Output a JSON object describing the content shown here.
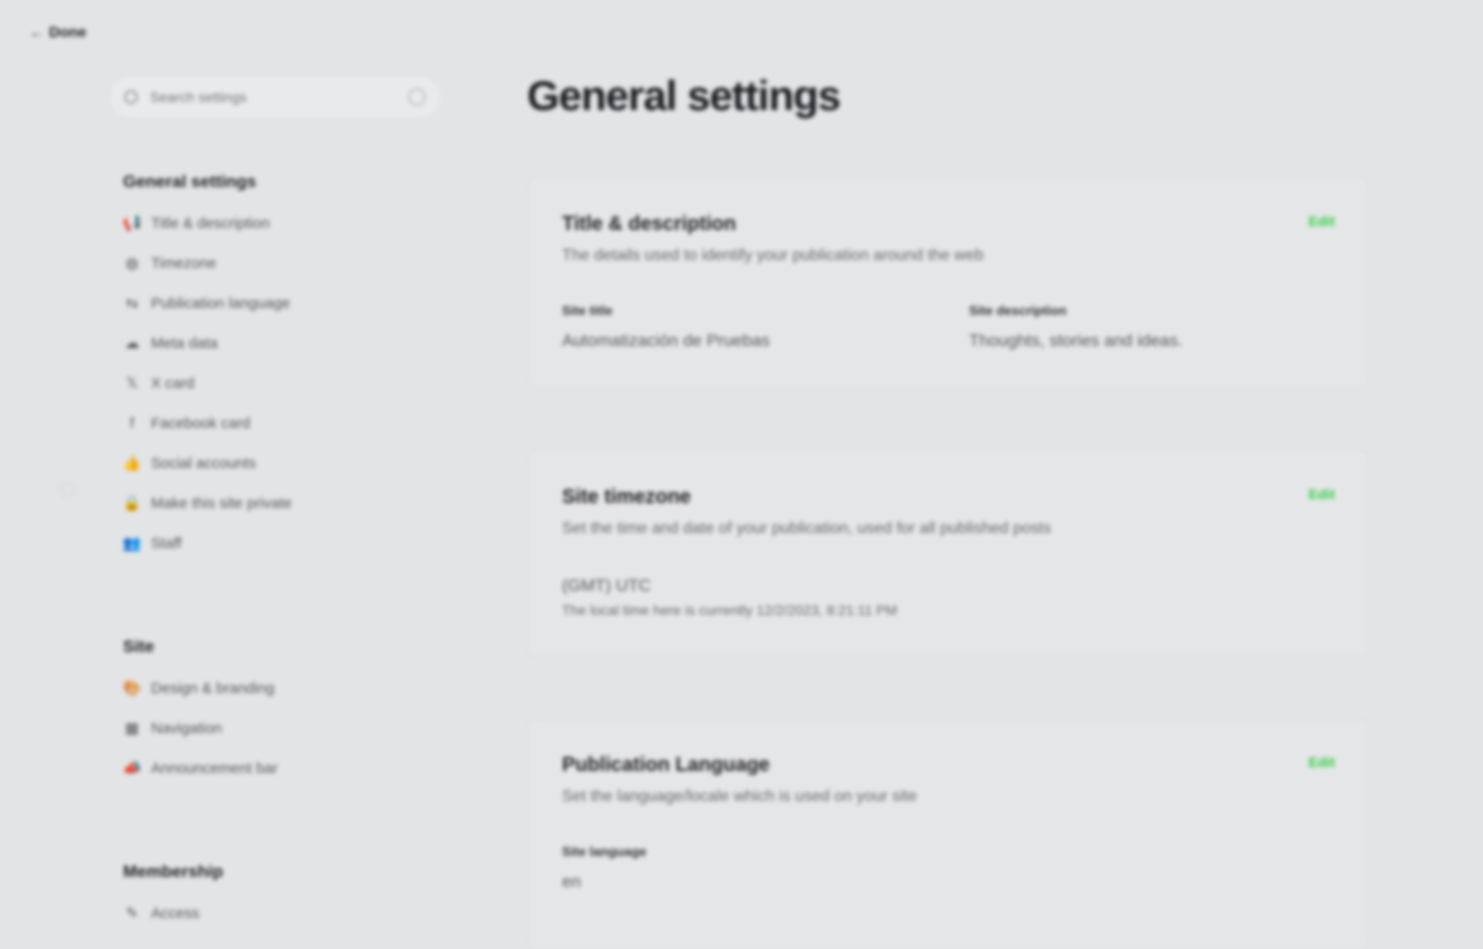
{
  "back_label": "Done",
  "search": {
    "placeholder": "Search settings"
  },
  "sidebar": {
    "groups": [
      {
        "title": "General settings",
        "items": [
          {
            "label": "Title & description",
            "icon": "megaphone-icon"
          },
          {
            "label": "Timezone",
            "icon": "globe-icon"
          },
          {
            "label": "Publication language",
            "icon": "translate-icon"
          },
          {
            "label": "Meta data",
            "icon": "brain-icon"
          },
          {
            "label": "X card",
            "icon": "x-logo-icon"
          },
          {
            "label": "Facebook card",
            "icon": "facebook-icon"
          },
          {
            "label": "Social accounts",
            "icon": "thumbs-up-icon"
          },
          {
            "label": "Make this site private",
            "icon": "lock-icon"
          },
          {
            "label": "Staff",
            "icon": "users-icon"
          }
        ]
      },
      {
        "title": "Site",
        "items": [
          {
            "label": "Design & branding",
            "icon": "palette-icon"
          },
          {
            "label": "Navigation",
            "icon": "grid-icon"
          },
          {
            "label": "Announcement bar",
            "icon": "announcement-icon"
          }
        ]
      },
      {
        "title": "Membership",
        "items": [
          {
            "label": "Access",
            "icon": "key-icon"
          }
        ]
      }
    ]
  },
  "main": {
    "title": "General settings",
    "cards": [
      {
        "title": "Title & description",
        "description": "The details used to identify your publication around the web",
        "edit": "Edit",
        "fields": [
          {
            "label": "Site title",
            "value": "Automatización de Pruebas"
          },
          {
            "label": "Site description",
            "value": "Thoughts, stories and ideas."
          }
        ]
      },
      {
        "title": "Site timezone",
        "description": "Set the time and date of your publication, used for all published posts",
        "edit": "Edit",
        "value": "(GMT) UTC",
        "note": "The local time here is currently 12/2/2023, 8:21:11 PM"
      },
      {
        "title": "Publication Language",
        "description": "Set the language/locale which is used on your site",
        "edit": "Edit",
        "fields": [
          {
            "label": "Site language",
            "value": "en"
          }
        ]
      }
    ]
  },
  "colors": {
    "accent": "#30cf43",
    "background": "#e3e4e6"
  }
}
